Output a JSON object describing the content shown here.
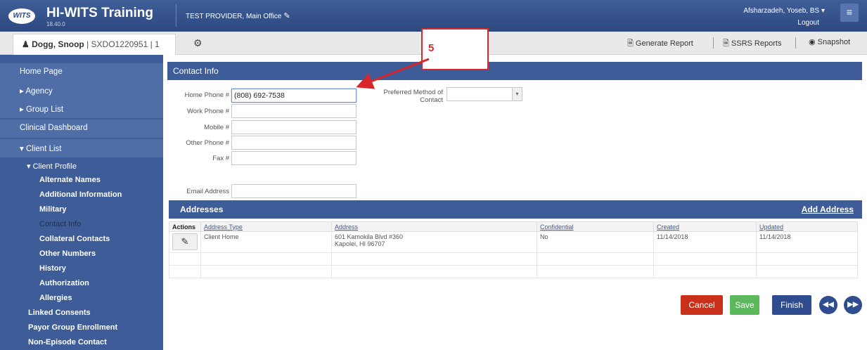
{
  "header": {
    "logo_text": "WITS",
    "app_title": "HI-WITS Training",
    "version": "18.40.0",
    "provider": "TEST PROVIDER, Main Office",
    "user": "Afsharzadeh, Yoseb, BS ▾",
    "logout": "Logout",
    "menu_icon": "≡"
  },
  "client": {
    "name": "Dogg, Snoop",
    "id": " | SXDO1220951 | 1"
  },
  "toolbar": {
    "generate_report": "Generate Report",
    "ssrs_reports": "SSRS Reports",
    "snapshot": "Snapshot"
  },
  "sidebar": {
    "home": "Home Page",
    "agency": "▸ Agency",
    "group_list": "▸ Group List",
    "clinical_dashboard": "Clinical Dashboard",
    "client_list": "▾ Client List",
    "client_profile": "▾ Client Profile",
    "sub_items": [
      "Alternate Names",
      "Additional Information",
      "Military",
      "Contact Info",
      "Collateral Contacts",
      "Other Numbers",
      "History",
      "Authorization",
      "Allergies"
    ],
    "linked_consents": "Linked Consents",
    "payor_group": "Payor Group Enrollment",
    "non_episode": "Non-Episode Contact",
    "active_item": "Contact Info"
  },
  "contact": {
    "title": "Contact Info",
    "home_phone_label": "Home Phone #",
    "home_phone_value": "(808) 692-7538",
    "work_phone_label": "Work Phone #",
    "mobile_label": "Mobile #",
    "other_phone_label": "Other Phone #",
    "fax_label": "Fax #",
    "email_label": "Email Address",
    "preferred_label_1": "Preferred Method of",
    "preferred_label_2": "Contact"
  },
  "addresses": {
    "title": "Addresses",
    "add_link": "Add Address",
    "columns": [
      "Actions",
      "Address Type",
      "Address",
      "Confidential",
      "Created",
      "Updated"
    ],
    "rows": [
      {
        "type": "Client Home",
        "address_line1": "601 Kamokila Blvd #360",
        "address_line2": "Kapolei, HI 96707",
        "confidential": "No",
        "created": "11/14/2018",
        "updated": "11/14/2018"
      }
    ]
  },
  "buttons": {
    "cancel": "Cancel",
    "save": "Save",
    "finish": "Finish",
    "prev": "◀◀",
    "next": "▶▶"
  },
  "annotation": {
    "step": "5",
    "color": "#d9262a"
  }
}
